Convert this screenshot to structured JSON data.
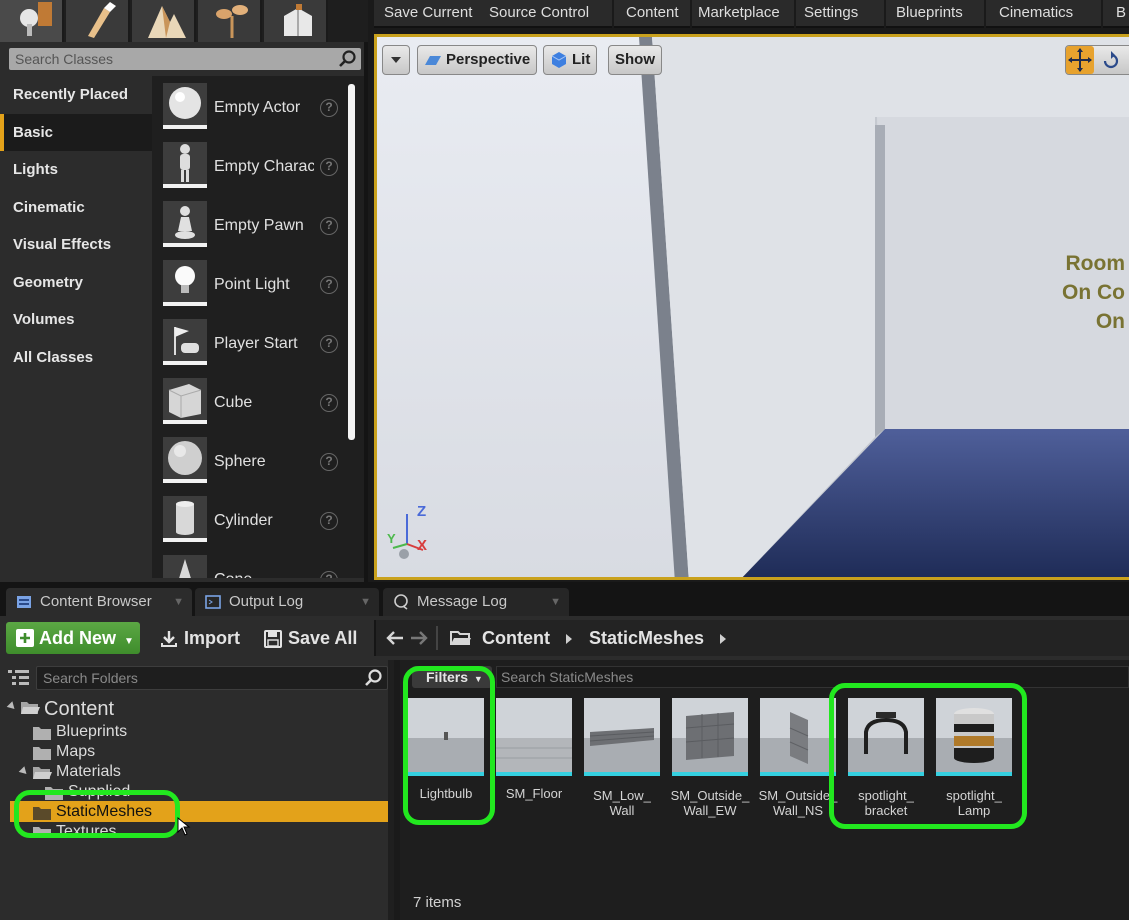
{
  "place_panel": {
    "search_placeholder": "Search Classes",
    "categories": [
      "Recently Placed",
      "Basic",
      "Lights",
      "Cinematic",
      "Visual Effects",
      "Geometry",
      "Volumes",
      "All Classes"
    ],
    "active_category": "Basic",
    "classes": [
      "Empty Actor",
      "Empty Character",
      "Empty Pawn",
      "Point Light",
      "Player Start",
      "Cube",
      "Sphere",
      "Cylinder",
      "Cone"
    ],
    "help_glyph": "?"
  },
  "main_toolbar": {
    "items": [
      "Save Current",
      "Source Control",
      "Content",
      "Marketplace",
      "Settings",
      "Blueprints",
      "Cinematics",
      "B"
    ]
  },
  "viewport": {
    "view_mode": "Perspective",
    "lighting": "Lit",
    "show": "Show",
    "wall_text": [
      "Room",
      "On Co",
      "On"
    ],
    "axes": {
      "z": "Z",
      "x": "X",
      "y": "Y"
    }
  },
  "bottom_tabs": [
    "Content Browser",
    "Output Log",
    "Message Log"
  ],
  "content_browser": {
    "add_new": "Add New",
    "import": "Import",
    "save_all": "Save All",
    "breadcrumb": [
      "Content",
      "StaticMeshes"
    ],
    "folder_search_placeholder": "Search Folders",
    "tree": {
      "root": "Content",
      "folders": [
        "Blueprints",
        "Maps",
        "Materials",
        "Supplied",
        "StaticMeshes",
        "Textures"
      ],
      "selected": "StaticMeshes"
    },
    "filters_label": "Filters",
    "asset_search_placeholder": "Search StaticMeshes",
    "assets": [
      "Lightbulb",
      "SM_Floor",
      "SM_Low_\nWall",
      "SM_Outside_\nWall_EW",
      "SM_Outside_\nWall_NS",
      "spotlight_\nbracket",
      "spotlight_\nLamp"
    ],
    "item_count": "7 items"
  },
  "colors": {
    "accent": "#e3a21a",
    "highlight": "#22e81f",
    "add_new": "#4a9a36",
    "tile_underline": "#35d0e0"
  }
}
